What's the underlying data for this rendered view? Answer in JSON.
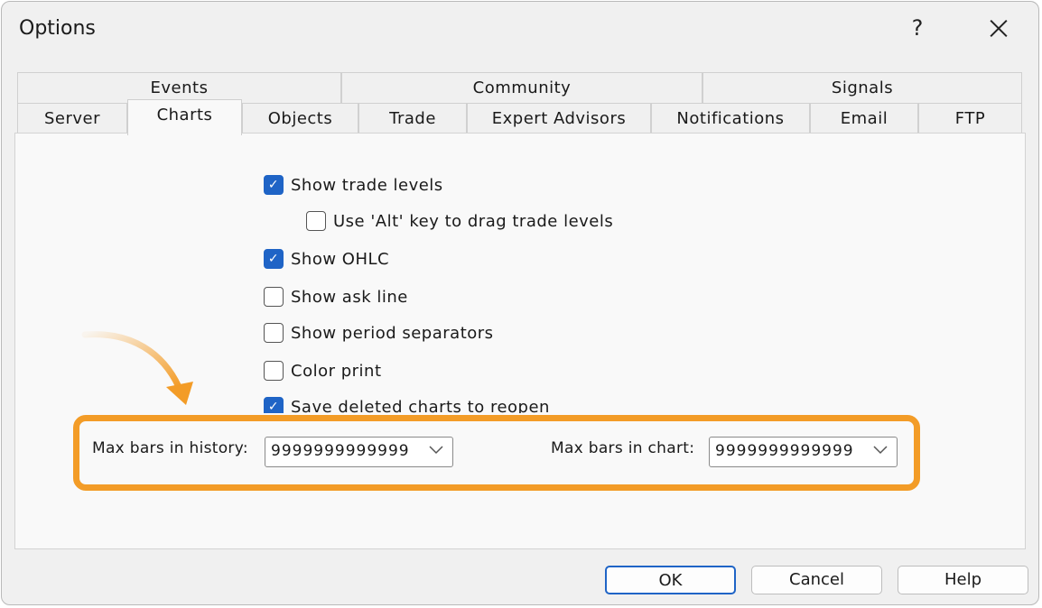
{
  "window": {
    "title": "Options",
    "help_glyph": "?"
  },
  "tabs": {
    "row1": [
      "Events",
      "Community",
      "Signals"
    ],
    "row2": [
      "Server",
      "Charts",
      "Objects",
      "Trade",
      "Expert Advisors",
      "Notifications",
      "Email",
      "FTP"
    ],
    "active": "Charts"
  },
  "charts": {
    "checkboxes": [
      {
        "label": "Show trade levels",
        "checked": true
      },
      {
        "label": "Use 'Alt' key to drag trade levels",
        "checked": false
      },
      {
        "label": "Show OHLC",
        "checked": true
      },
      {
        "label": "Show ask line",
        "checked": false
      },
      {
        "label": "Show period separators",
        "checked": false
      },
      {
        "label": "Color print",
        "checked": false
      },
      {
        "label": "Save deleted charts to reopen",
        "checked": true
      }
    ],
    "max_bars_history": {
      "label": "Max bars in history:",
      "value": "9999999999999"
    },
    "max_bars_chart": {
      "label": "Max bars in chart:",
      "value": "9999999999999"
    }
  },
  "buttons": {
    "ok": "OK",
    "cancel": "Cancel",
    "help": "Help"
  },
  "colors": {
    "accent": "#1f64c6",
    "highlight": "#f39c27"
  },
  "icons": {
    "close": "close-icon",
    "dropdown": "chevron-down-icon",
    "check": "checkmark-icon"
  }
}
